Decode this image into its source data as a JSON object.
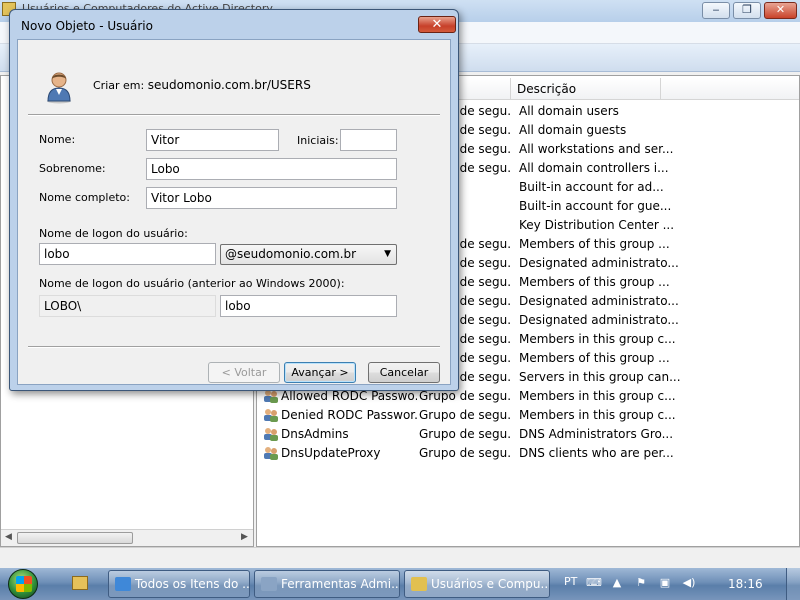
{
  "background": {
    "title": "Usuários e Computadores do Active Directory",
    "columns": {
      "description": "Descrição"
    },
    "rows": [
      {
        "name": "",
        "type": "Grupo de segu...",
        "description": "All domain users"
      },
      {
        "name": "",
        "type": "Grupo de segu...",
        "description": "All domain guests"
      },
      {
        "name": "",
        "type": "Grupo de segu...",
        "description": "All workstations and ser..."
      },
      {
        "name": "",
        "type": "Grupo de segu...",
        "description": "All domain controllers i..."
      },
      {
        "name": "",
        "type": "",
        "description": "Built-in account for ad..."
      },
      {
        "name": "",
        "type": "",
        "description": "Built-in account for gue..."
      },
      {
        "name": "",
        "type": "",
        "description": "Key Distribution Center ..."
      },
      {
        "name": "",
        "type": "Grupo de segu...",
        "description": "Members of this group ..."
      },
      {
        "name": "",
        "type": "Grupo de segu...",
        "description": "Designated administrato..."
      },
      {
        "name": "",
        "type": "Grupo de segu...",
        "description": "Members of this group ..."
      },
      {
        "name": "",
        "type": "Grupo de segu...",
        "description": "Designated administrato..."
      },
      {
        "name": "",
        "type": "Grupo de segu...",
        "description": "Designated administrato..."
      },
      {
        "name": "",
        "type": "Grupo de segu...",
        "description": "Members in this group c..."
      },
      {
        "name": "",
        "type": "Grupo de segu...",
        "description": "Members of this group ..."
      },
      {
        "name": "",
        "type": "Grupo de segu...",
        "description": "Servers in this group can..."
      },
      {
        "name": "Allowed RODC Passwo...",
        "type": "Grupo de segu...",
        "description": "Members in this group c..."
      },
      {
        "name": "Denied RODC Passwor...",
        "type": "Grupo de segu...",
        "description": "Members in this group c..."
      },
      {
        "name": "DnsAdmins",
        "type": "Grupo de segu...",
        "description": "DNS Administrators Gro..."
      },
      {
        "name": "DnsUpdateProxy",
        "type": "Grupo de segu...",
        "description": "DNS clients who are per..."
      }
    ]
  },
  "dialog": {
    "title": "Novo Objeto - Usuário",
    "close_glyph": "✕",
    "create_in_label": "Criar em:",
    "create_in_path": "seudomonio.com.br/USERS",
    "first_name_label": "Nome:",
    "first_name_value": "Vitor",
    "initials_label": "Iniciais:",
    "initials_value": "",
    "last_name_label": "Sobrenome:",
    "last_name_value": "Lobo",
    "full_name_label": "Nome completo:",
    "full_name_value": "Vitor Lobo",
    "logon_label": "Nome de logon do usuário:",
    "logon_value": "lobo",
    "domain_value": "@seudomonio.com.br",
    "legacy_logon_label": "Nome de logon do usuário (anterior ao Windows 2000):",
    "legacy_domain_value": "LOBO\\",
    "legacy_logon_value": "lobo",
    "back_button": "< Voltar",
    "next_button": "Avançar >",
    "cancel_button": "Cancelar"
  },
  "taskbar": {
    "buttons": [
      {
        "label": "Todos os Itens do ...",
        "icon": "control-panel-icon",
        "color": "#3f88d8"
      },
      {
        "label": "Ferramentas Admi...",
        "icon": "admin-tools-icon",
        "color": "#8aa4c4"
      },
      {
        "label": "Usuários e Compu...",
        "icon": "ad-users-icon",
        "color": "#e2c050"
      }
    ],
    "language": "PT",
    "clock": "18:16"
  }
}
